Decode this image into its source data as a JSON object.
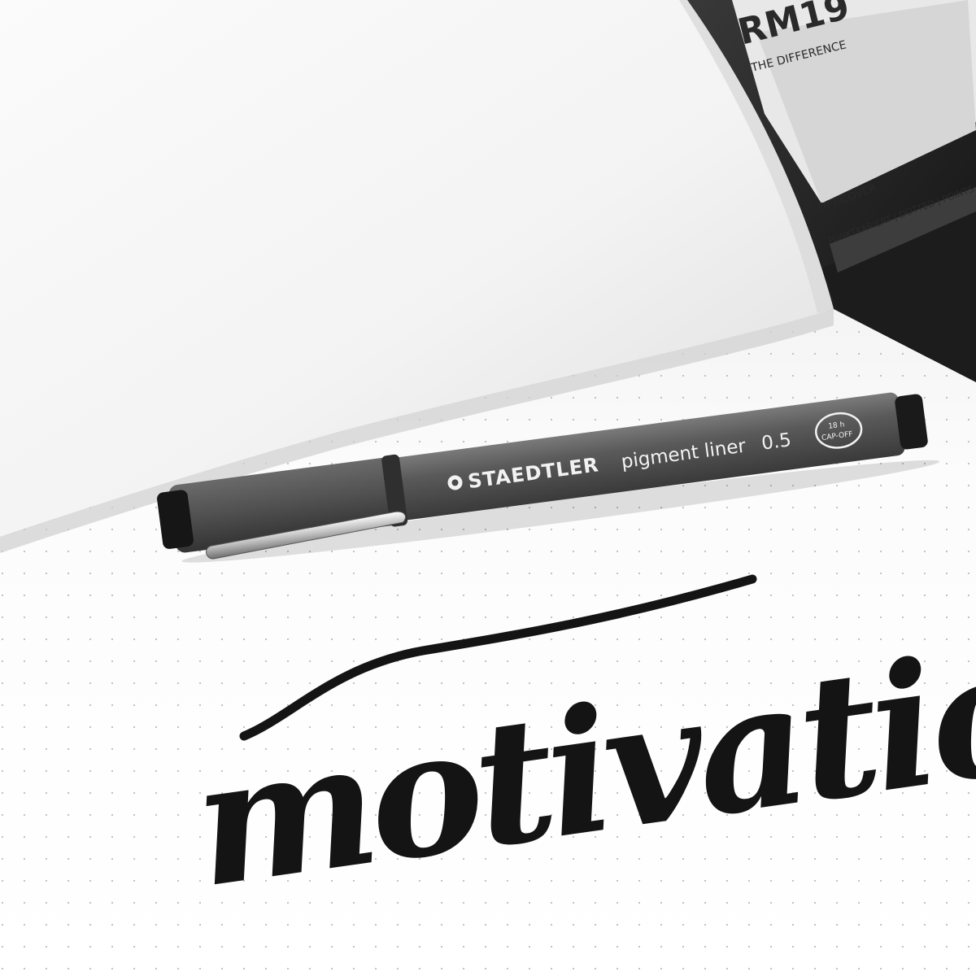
{
  "scene": {
    "description_colors": {
      "paper": "#ffffff",
      "shadow_page": "#e2e2e2",
      "pen_barrel": "#545454",
      "ink": "#141414",
      "notebook_cover": "#222222"
    }
  },
  "notebook": {
    "cover_brand": "RM19",
    "cover_tagline": "THE DIFFERENCE",
    "cover_label_1": "OFT COVER",
    "cover_label_2": "PUNKTKARIERT | DOTTED | POINTS"
  },
  "pen": {
    "brand": "STAEDTLER",
    "model": "pigment liner",
    "size": "0.5",
    "badge_line_1": "18 h",
    "badge_line_2": "CAP-OFF"
  },
  "lettering": {
    "word": "motivation"
  }
}
